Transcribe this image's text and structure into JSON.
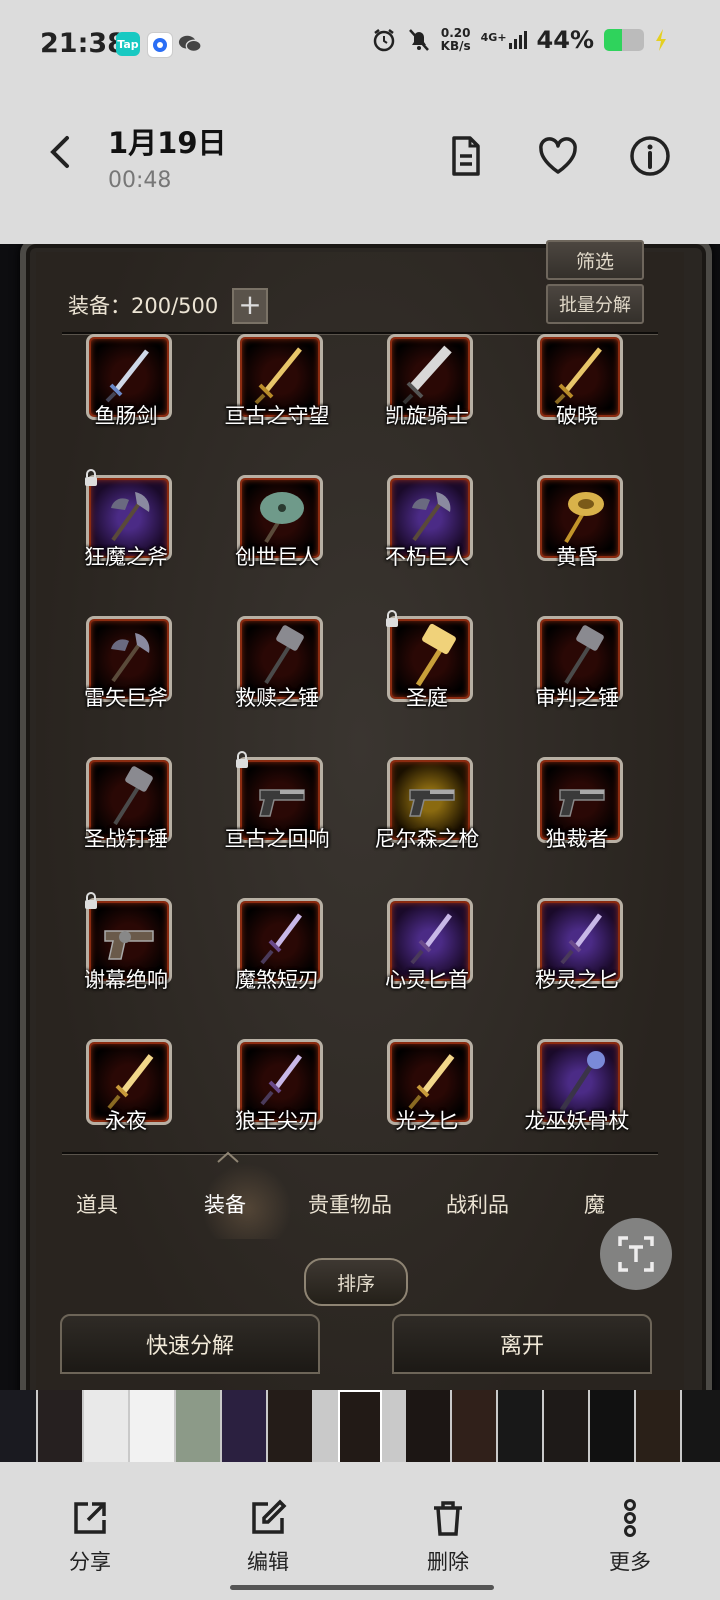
{
  "status_bar": {
    "time": "21:38",
    "apps": [
      {
        "name": "tap-app-icon",
        "label": "Tap",
        "color": "#18c9c2"
      },
      {
        "name": "browser-app-icon",
        "label": "",
        "color": "#2a6ef5"
      },
      {
        "name": "wechat-icon",
        "label": "",
        "color": "#555555"
      }
    ],
    "net_speed": "0.20",
    "net_speed_unit": "KB/s",
    "network": "4G+",
    "battery_text": "44%",
    "battery_level": 0.44
  },
  "header": {
    "title": "1月19日",
    "subtitle": "00:48"
  },
  "game": {
    "filter_label": "筛选",
    "bulk_decompose_label": "批量分解",
    "equipment_count": "装备：200/500",
    "add_symbol": "+",
    "items": [
      {
        "name": "鱼肠剑",
        "locked": false,
        "bg": "red",
        "icon": "sword"
      },
      {
        "name": "亘古之守望",
        "locked": false,
        "bg": "red",
        "icon": "sword-gold"
      },
      {
        "name": "凯旋骑士",
        "locked": false,
        "bg": "red",
        "icon": "greatsword"
      },
      {
        "name": "破晓",
        "locked": false,
        "bg": "red",
        "icon": "sword-gold"
      },
      {
        "name": "狂魔之斧",
        "locked": true,
        "bg": "purple",
        "icon": "axe"
      },
      {
        "name": "创世巨人",
        "locked": false,
        "bg": "red",
        "icon": "axe-green"
      },
      {
        "name": "不朽巨人",
        "locked": false,
        "bg": "purple",
        "icon": "axe"
      },
      {
        "name": "黄昏",
        "locked": false,
        "bg": "red",
        "icon": "axe-gold"
      },
      {
        "name": "雷矢巨斧",
        "locked": false,
        "bg": "red",
        "icon": "axe"
      },
      {
        "name": "救赎之锤",
        "locked": false,
        "bg": "red",
        "icon": "hammer"
      },
      {
        "name": "圣庭",
        "locked": true,
        "bg": "red",
        "icon": "hammer-gold"
      },
      {
        "name": "审判之锤",
        "locked": false,
        "bg": "red",
        "icon": "hammer"
      },
      {
        "name": "圣战钉锤",
        "locked": false,
        "bg": "red",
        "icon": "hammer"
      },
      {
        "name": "亘古之回响",
        "locked": true,
        "bg": "red",
        "icon": "pistol"
      },
      {
        "name": "尼尔森之枪",
        "locked": false,
        "bg": "gold",
        "icon": "pistol"
      },
      {
        "name": "独裁者",
        "locked": false,
        "bg": "red",
        "icon": "pistol"
      },
      {
        "name": "谢幕绝响",
        "locked": true,
        "bg": "red",
        "icon": "revolver"
      },
      {
        "name": "魔煞短刃",
        "locked": false,
        "bg": "red",
        "icon": "dagger"
      },
      {
        "name": "心灵匕首",
        "locked": false,
        "bg": "purple",
        "icon": "dagger"
      },
      {
        "name": "秽灵之匕",
        "locked": false,
        "bg": "purple",
        "icon": "dagger"
      },
      {
        "name": "永夜",
        "locked": false,
        "bg": "red",
        "icon": "dagger-gold"
      },
      {
        "name": "狼王尖刃",
        "locked": false,
        "bg": "red",
        "icon": "dagger"
      },
      {
        "name": "光之匕",
        "locked": false,
        "bg": "red",
        "icon": "dagger-gold"
      },
      {
        "name": "龙巫妖骨杖",
        "locked": false,
        "bg": "purple",
        "icon": "staff"
      }
    ],
    "tabs": [
      "道具",
      "装备",
      "贵重物品",
      "战利品",
      "魔"
    ],
    "active_tab": "装备",
    "sort_label": "排序",
    "quick_decompose_label": "快速分解",
    "leave_label": "离开"
  },
  "toolbar": {
    "share": "分享",
    "edit": "编辑",
    "delete": "删除",
    "more": "更多"
  }
}
